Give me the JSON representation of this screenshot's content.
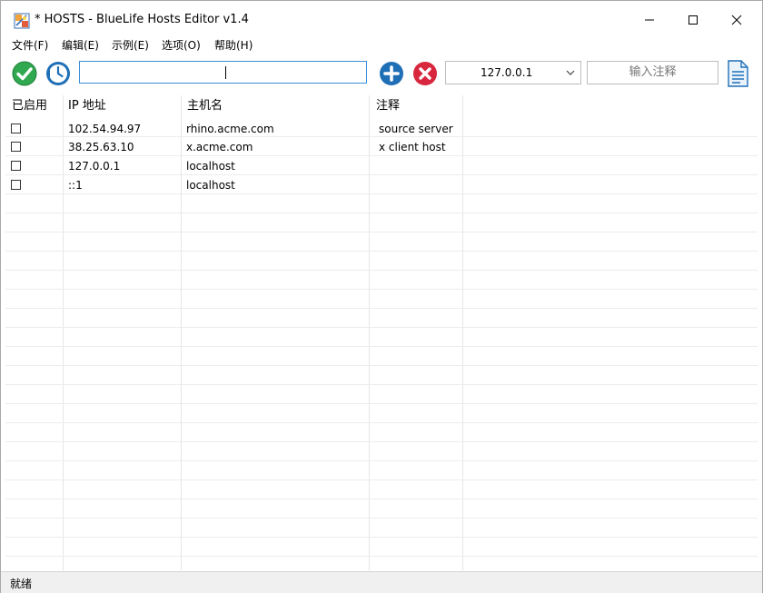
{
  "window": {
    "title": "* HOSTS - BlueLife Hosts Editor v1.4"
  },
  "menu": [
    {
      "label": "文件(F)"
    },
    {
      "label": "编辑(E)"
    },
    {
      "label": "示例(E)"
    },
    {
      "label": "选项(O)"
    },
    {
      "label": "帮助(H)"
    }
  ],
  "toolbar": {
    "hostname_value": "",
    "ip_selected": "127.0.0.1",
    "comment_placeholder": "输入注释",
    "icons": [
      "apply-checkmark-icon",
      "update-clock-icon",
      "add-plus-icon",
      "delete-x-icon",
      "document-icon"
    ]
  },
  "columns": [
    "已启用",
    "IP 地址",
    "主机名",
    "注释"
  ],
  "rows": [
    {
      "enabled": false,
      "ip": "102.54.94.97",
      "host": "rhino.acme.com",
      "comment": "source server"
    },
    {
      "enabled": false,
      "ip": "38.25.63.10",
      "host": "x.acme.com",
      "comment": "x client host"
    },
    {
      "enabled": false,
      "ip": "127.0.0.1",
      "host": "localhost",
      "comment": ""
    },
    {
      "enabled": false,
      "ip": "::1",
      "host": "localhost",
      "comment": ""
    }
  ],
  "status": {
    "text": "就绪"
  },
  "colors": {
    "green": "#2fa84f",
    "blue": "#1f6fb7",
    "red": "#d7263d",
    "accent_border": "#3c8fd8"
  }
}
